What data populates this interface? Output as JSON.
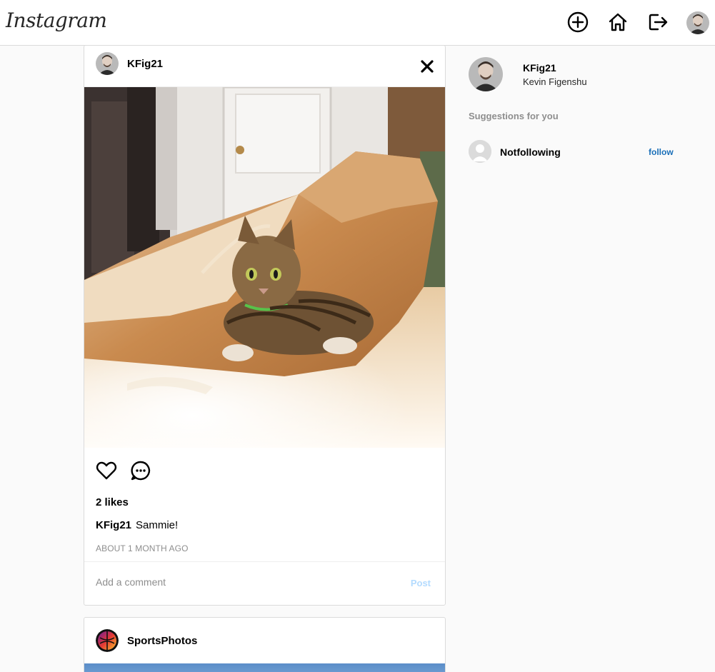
{
  "header": {
    "logo": "Instagram",
    "icons": [
      "add-post-icon",
      "home-icon",
      "logout-icon"
    ]
  },
  "posts": [
    {
      "username": "KFig21",
      "likes": "2 likes",
      "caption_user": "KFig21",
      "caption_text": "Sammie!",
      "time": "ABOUT 1 MONTH AGO",
      "comment_placeholder": "Add a comment",
      "post_label": "Post"
    },
    {
      "username": "SportsPhotos"
    }
  ],
  "sidebar": {
    "username": "KFig21",
    "full_name": "Kevin Figenshu",
    "suggestions_title": "Suggestions for you",
    "suggestions": [
      {
        "username": "Notfollowing",
        "action": "follow"
      }
    ]
  },
  "colors": {
    "border": "#dbdbdb",
    "background": "#fafafa",
    "follow_link": "#1a6fb8",
    "post_button_disabled": "#b3dbff",
    "muted": "#8e8e8e"
  }
}
